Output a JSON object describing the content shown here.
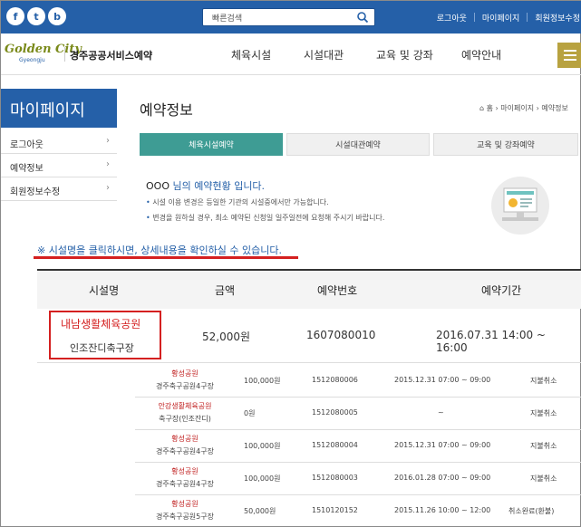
{
  "topbar": {
    "social": [
      "f",
      "t",
      "b"
    ],
    "search_placeholder": "빠른검색",
    "links": [
      "로그아웃",
      "마이페이지",
      "회원정보수정"
    ]
  },
  "header": {
    "logo_en": "Golden City",
    "logo_sub": "Gyeongju",
    "logo_ko": "경주공공서비스예약",
    "gnb": [
      "체육시설",
      "시설대관",
      "교육 및 강좌",
      "예약안내"
    ]
  },
  "sidebar": {
    "title": "마이페이지",
    "items": [
      {
        "label": "로그아웃"
      },
      {
        "label": "예약정보"
      },
      {
        "label": "회원정보수정"
      }
    ]
  },
  "main": {
    "title": "예약정보",
    "breadcrumb": [
      "홈",
      "마이페이지",
      "예약정보"
    ],
    "tabs": [
      {
        "label": "체육시설예약",
        "active": true
      },
      {
        "label": "시설대관예약",
        "active": false
      },
      {
        "label": "교육 및 강좌예약",
        "active": false
      }
    ],
    "notice": {
      "name": "OOO",
      "title_rest": "님의 예약현황 입니다.",
      "lines": [
        "시설 이용 변경은 등일한 기관의 시설중에서만 가능합니다.",
        "변경을 원하실 경우, 최소 예약된 신청일 일주일전에 요청해 주시기 바랍니다."
      ]
    },
    "hint": "※ 시설명을 클릭하시면, 상세내용을 확인하실 수 있습니다."
  },
  "table": {
    "headers": [
      "시설명",
      "금액",
      "예약번호",
      "예약기간"
    ],
    "featured": {
      "facility": "내남생활체육공원",
      "sub": "인조잔디축구장",
      "amount": "52,000원",
      "number": "1607080010",
      "period": "2016.07.31 14:00 ~ 16:00"
    },
    "rows": [
      {
        "facility": "황성공원",
        "sub": "경주축구공원4구장",
        "amount": "100,000원",
        "number": "1512080006",
        "period": "2015.12.31 07:00 ~ 09:00",
        "status": "지불취소"
      },
      {
        "facility": "안강생활체육공원",
        "sub": "축구장(인조잔디)",
        "amount": "0원",
        "number": "1512080005",
        "period": "~",
        "status": "지불취소"
      },
      {
        "facility": "황성공원",
        "sub": "경주축구공원4구장",
        "amount": "100,000원",
        "number": "1512080004",
        "period": "2015.12.31 07:00 ~ 09:00",
        "status": "지불취소"
      },
      {
        "facility": "황성공원",
        "sub": "경주축구공원4구장",
        "amount": "100,000원",
        "number": "1512080003",
        "period": "2016.01.28 07:00 ~ 09:00",
        "status": "지불취소"
      },
      {
        "facility": "황성공원",
        "sub": "경주축구공원5구장",
        "amount": "50,000원",
        "number": "1510120152",
        "period": "2015.11.26 10:00 ~ 12:00",
        "status": "취소완료(환불)"
      }
    ]
  }
}
